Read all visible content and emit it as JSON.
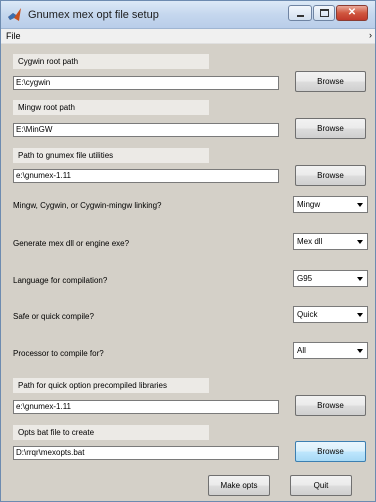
{
  "window": {
    "title": "Gnumex mex opt file setup"
  },
  "menu": {
    "file": "File",
    "overflow_arrow": "›"
  },
  "cygwin": {
    "label": "Cygwin root path",
    "value": "E:\\cygwin",
    "browse": "Browse"
  },
  "mingw": {
    "label": "Mingw root path",
    "value": "E:\\MinGW",
    "browse": "Browse"
  },
  "utilities": {
    "label": "Path to gnumex file utilities",
    "value": "e:\\gnumex-1.11",
    "browse": "Browse"
  },
  "linking": {
    "label": "Mingw, Cygwin, or Cygwin-mingw linking?",
    "selected": "Mingw"
  },
  "generate": {
    "label": "Generate mex dll or engine exe?",
    "selected": "Mex dll"
  },
  "language": {
    "label": "Language for compilation?",
    "selected": "G95"
  },
  "compile_mode": {
    "label": "Safe or quick compile?",
    "selected": "Quick"
  },
  "processor": {
    "label": "Processor to compile for?",
    "selected": "All"
  },
  "precompiled": {
    "label": "Path for quick option precompiled libraries",
    "value": "e:\\gnumex-1.11",
    "browse": "Browse"
  },
  "opts_file": {
    "label": "Opts bat file to create",
    "value": "D:\\rrqr\\mexopts.bat",
    "browse": "Browse"
  },
  "actions": {
    "make": "Make opts",
    "quit": "Quit"
  },
  "icons": {
    "app": "matlab-logo-icon",
    "minimize": "minimize-icon",
    "maximize": "maximize-icon",
    "close": "close-icon"
  }
}
